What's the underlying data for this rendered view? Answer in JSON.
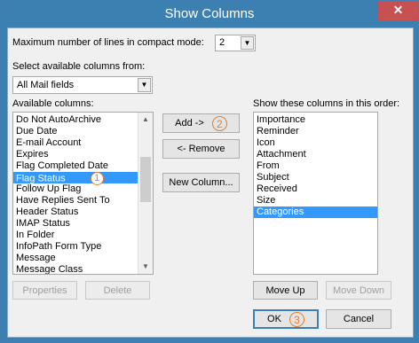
{
  "window": {
    "title": "Show Columns",
    "close_glyph": "✕"
  },
  "compact": {
    "label": "Maximum number of lines in compact mode:",
    "value": "2"
  },
  "source": {
    "label": "Select available columns from:",
    "value": "All Mail fields"
  },
  "available": {
    "label": "Available columns:",
    "items": [
      "Do Not AutoArchive",
      "Due Date",
      "E-mail Account",
      "Expires",
      "Flag Completed Date",
      "Flag Status",
      "Follow Up Flag",
      "Have Replies Sent To",
      "Header Status",
      "IMAP Status",
      "In Folder",
      "InfoPath Form Type",
      "Message",
      "Message Class"
    ],
    "selected": "Flag Status",
    "selected_badge": "1"
  },
  "shown": {
    "label": "Show these columns in this order:",
    "items": [
      "Importance",
      "Reminder",
      "Icon",
      "Attachment",
      "From",
      "Subject",
      "Received",
      "Size",
      "Categories"
    ],
    "selected": "Categories"
  },
  "buttons": {
    "add": "Add ->",
    "add_badge": "2",
    "remove": "<- Remove",
    "new_column": "New Column...",
    "properties": "Properties",
    "delete": "Delete",
    "move_up": "Move Up",
    "move_down": "Move Down",
    "ok": "OK",
    "ok_badge": "3",
    "cancel": "Cancel"
  },
  "colors": {
    "titlebar": "#3c7fb1",
    "selection": "#3399ff",
    "annotation": "#e87c2a"
  }
}
